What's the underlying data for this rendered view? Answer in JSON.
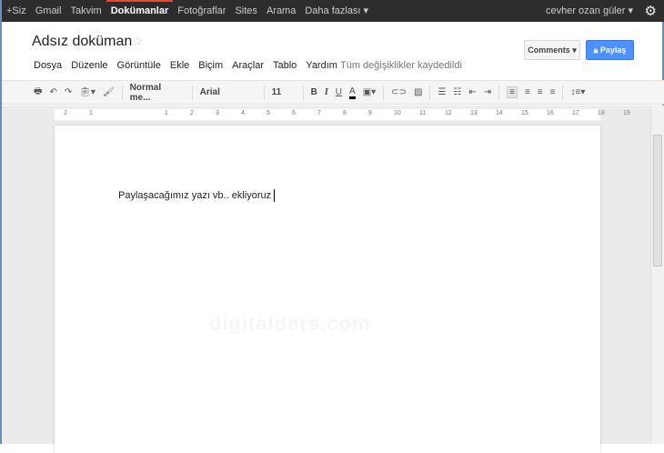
{
  "topbar": {
    "items": [
      "+Siz",
      "Gmail",
      "Takvim",
      "Dokümanlar",
      "Fotoğraflar",
      "Sites",
      "Arama",
      "Daha fazlası ▾"
    ],
    "user": "cevher ozan güler ▾"
  },
  "doc": {
    "title": "Adsız doküman",
    "saved_status": "Tüm değişiklikler kaydedildi",
    "body": "Paylaşacağımız yazı vb..  ekliyoruz",
    "watermark": "digitalders.com"
  },
  "menu": [
    "Dosya",
    "Düzenle",
    "Görüntüle",
    "Ekle",
    "Biçim",
    "Araçlar",
    "Tablo",
    "Yardım"
  ],
  "buttons": {
    "comments": "Comments ▾",
    "share": "Paylaş"
  },
  "toolbar": {
    "style": "Normal me...",
    "font": "Arial",
    "size": "11",
    "bold": "B",
    "italic": "I",
    "underline": "U",
    "textcolor": "A"
  },
  "ruler": [
    "2",
    "1",
    "1",
    "2",
    "3",
    "4",
    "5",
    "6",
    "7",
    "8",
    "9",
    "10",
    "11",
    "12",
    "13",
    "14",
    "15",
    "16",
    "17",
    "18",
    "19"
  ],
  "colors": {
    "topbar": "#2d2d2d",
    "accent": "#4d90fe",
    "active": "#dd4b39"
  }
}
